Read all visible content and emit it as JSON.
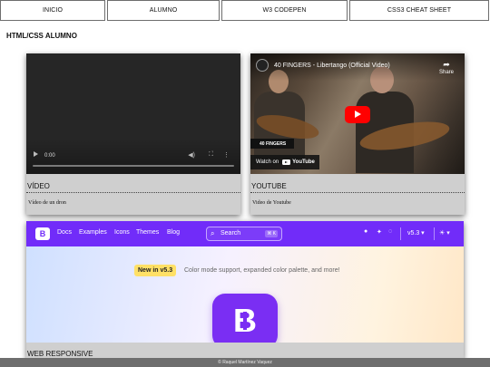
{
  "nav": {
    "items": [
      "INICIO",
      "ALUMNO",
      "W3 CODEPEN",
      "CSS3 CHEAT SHEET"
    ]
  },
  "page": {
    "heading": "HTML/CSS ALUMNO"
  },
  "cards": [
    {
      "title": "VÍDEO",
      "description": "Vídeo de un dron",
      "player": {
        "time": "0:00",
        "progress": 0
      }
    },
    {
      "title": "YOUTUBE",
      "description": "Video de Youtube",
      "embed": {
        "video_title": "40 FINGERS - Libertango (Official Video)",
        "share_label": "Share",
        "badge": "40 FINGERS",
        "watch_on": "Watch on",
        "youtube_wordmark": "YouTube"
      }
    },
    {
      "title": "WEB RESPONSIVE",
      "site": {
        "brand_letter": "B",
        "links": [
          "Docs",
          "Examples",
          "Icons",
          "Themes",
          "Blog"
        ],
        "search_placeholder": "Search",
        "search_shortcut": "⌘ K",
        "version": "v5.3",
        "hero_badge": "New in v5.3",
        "hero_text": "Color mode support, expanded color palette, and more!",
        "accent_color": "#712cf9"
      }
    }
  ],
  "footer": {
    "text": "© Raquel Martínez Vaquez"
  }
}
